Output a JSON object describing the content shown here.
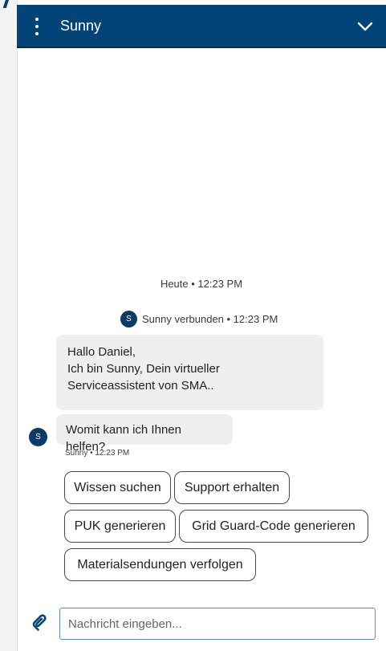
{
  "header": {
    "title": "Sunny"
  },
  "chat": {
    "timestamp": "Heute • 12:23 PM",
    "avatar_initial": "S",
    "connected_text": "Sunny verbunden • 12:23 PM",
    "messages": [
      {
        "lines": [
          "Hallo Daniel,",
          "Ich bin Sunny, Dein virtueller",
          "Serviceassistent von SMA.."
        ]
      },
      {
        "text": "Womit kann ich Ihnen helfen?"
      }
    ],
    "meta": "Sunny • 12:23 PM"
  },
  "quick_replies": [
    "Wissen suchen",
    "Support erhalten",
    "PUK generieren",
    "Grid Guard-Code generieren",
    "Materialsendungen verfolgen"
  ],
  "composer": {
    "placeholder": "Nachricht eingeben..."
  },
  "colors": {
    "header": "#034478",
    "avatar": "#0b3b66",
    "bubble": "#efefef",
    "input_border": "#5a8fbf"
  },
  "icons": [
    "menu-icon",
    "chevron-down-icon",
    "attach-icon"
  ]
}
